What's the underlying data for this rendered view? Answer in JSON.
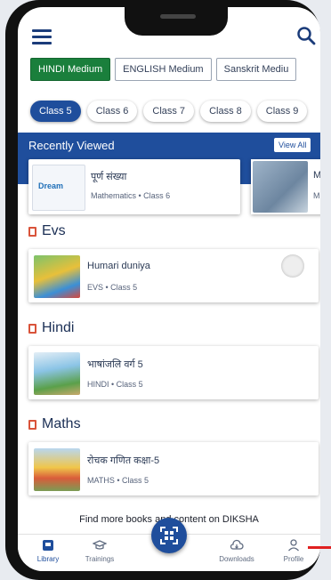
{
  "mediums": [
    "HINDI Medium",
    "ENGLISH Medium",
    "Sanskrit Mediu"
  ],
  "classes": [
    "Class 5",
    "Class 6",
    "Class 7",
    "Class 8",
    "Class 9"
  ],
  "recently_viewed": {
    "title": "Recently Viewed",
    "view_all": "View All",
    "card1": {
      "title": "पूर्ण संख्या",
      "subtitle": "Mathematics • Class 6",
      "thumb_text": "Dream"
    },
    "card2": {
      "title": "M",
      "subtitle": "M"
    }
  },
  "sections": [
    {
      "label": "Evs",
      "book_title": "Humari duniya",
      "book_subtitle": "EVS • Class 5"
    },
    {
      "label": "Hindi",
      "book_title": "भाषांजलि वर्ग 5",
      "book_subtitle": "HINDI • Class 5"
    },
    {
      "label": "Maths",
      "book_title": "रोचक गणित कक्षा-5",
      "book_subtitle": "MATHS • Class 5"
    }
  ],
  "find_more": "Find more books and content on DIKSHA",
  "bottom_nav": {
    "library": "Library",
    "trainings": "Trainings",
    "downloads": "Downloads",
    "profile": "Profile"
  },
  "colors": {
    "brand_blue": "#1f4e9c",
    "medium_active": "#1a7f3c",
    "section_icon": "#d9533a"
  },
  "icons": [
    "menu-icon",
    "search-icon",
    "qr-scan-icon",
    "library-icon",
    "trainings-icon",
    "downloads-icon",
    "profile-icon"
  ]
}
